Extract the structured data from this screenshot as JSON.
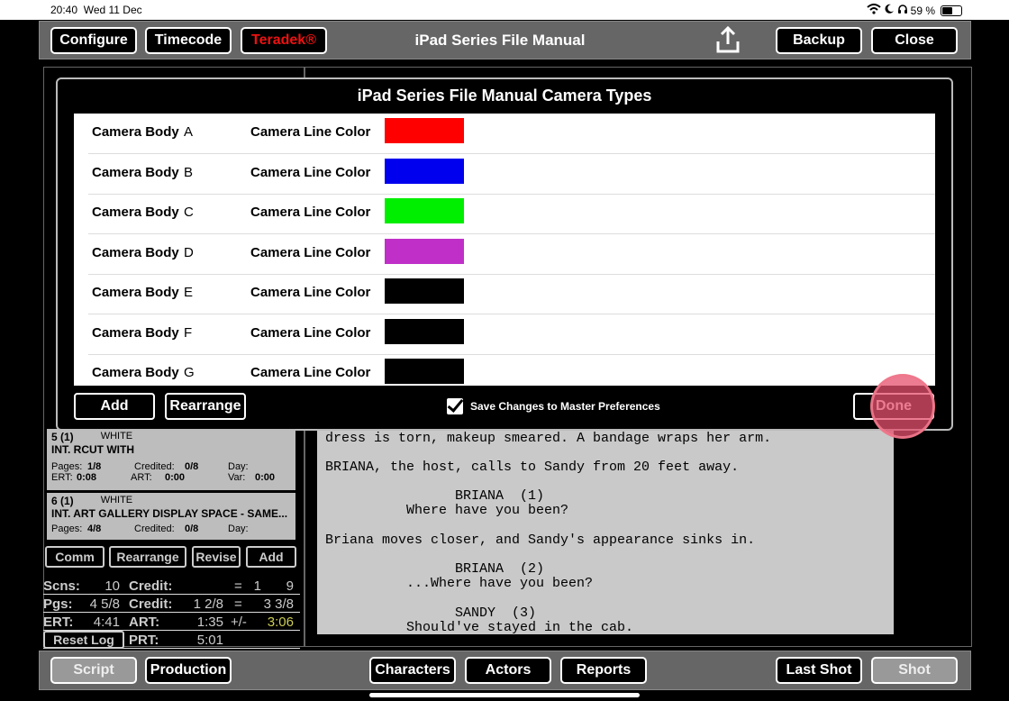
{
  "status_bar": {
    "time": "20:40",
    "date": "Wed 11 Dec",
    "battery_text": "59 %",
    "battery_level": 0.59
  },
  "toolbar": {
    "configure": "Configure",
    "timecode": "Timecode",
    "teradek": "Teradek®",
    "title": "iPad Series File Manual",
    "backup": "Backup",
    "close": "Close",
    "teradek_color": "#e11111"
  },
  "scenes": [
    {
      "num": "5 (1)",
      "color": "WHITE",
      "heading": "INT. RCUT WITH",
      "pages_label": "Pages:",
      "pages": "1/8",
      "credited_label": "Credited:",
      "credited": "0/8",
      "day_label": "Day:",
      "ert_label": "ERT:",
      "ert": "0:08",
      "art_label": "ART:",
      "art": "0:00",
      "var_label": "Var:",
      "var": "0:00"
    },
    {
      "num": "6 (1)",
      "color": "WHITE",
      "heading": "INT. ART GALLERY DISPLAY SPACE - SAME...",
      "pages_label": "Pages:",
      "pages": "4/8",
      "credited_label": "Credited:",
      "credited": "0/8",
      "day_label": "Day:"
    }
  ],
  "left_buttons": {
    "comm": "Comm",
    "rearrange": "Rearrange",
    "revise": "Revise",
    "add": "Add",
    "reset_log": "Reset Log"
  },
  "stats": {
    "scns_label": "Scns:",
    "scns": "10",
    "credit_label": "Credit:",
    "credit_scns": "1",
    "eq": "=",
    "scns_total": "9",
    "pgs_label": "Pgs:",
    "pgs": "4 5/8",
    "credit_pgs_label": "Credit:",
    "credit_pgs": "1 2/8",
    "pgs_total": "3 3/8",
    "ert_label": "ERT:",
    "ert": "4:41",
    "art_label": "ART:",
    "art": "1:35",
    "pm": "+/-",
    "diff": "3:06",
    "prt_label": "PRT:",
    "prt": "5:01"
  },
  "script_lines": [
    "dress is torn, makeup smeared. A bandage wraps her arm.",
    "BRIANA, the host, calls to Sandy from 20 feet away.",
    "                BRIANA  (1)",
    "          Where have you been?",
    "Briana moves closer, and Sandy's appearance sinks in.",
    "                BRIANA  (2)",
    "          ...Where have you been?",
    "                SANDY  (3)",
    "          Should've stayed in the cab."
  ],
  "bottom_bar": {
    "script": "Script",
    "production": "Production",
    "characters": "Characters",
    "actors": "Actors",
    "reports": "Reports",
    "last_shot": "Last Shot",
    "shot": "Shot"
  },
  "modal": {
    "title": "iPad Series File Manual Camera Types",
    "body_label": "Camera Body",
    "line_label": "Camera Line Color",
    "cameras": [
      {
        "letter": "A",
        "color": "#ff0000"
      },
      {
        "letter": "B",
        "color": "#0000ee"
      },
      {
        "letter": "C",
        "color": "#00ee00"
      },
      {
        "letter": "D",
        "color": "#c030c8"
      },
      {
        "letter": "E",
        "color": "#000000"
      },
      {
        "letter": "F",
        "color": "#000000"
      },
      {
        "letter": "G",
        "color": "#000000"
      }
    ],
    "add": "Add",
    "rearrange": "Rearrange",
    "save_label": "Save Changes to Master Preferences",
    "done": "Done"
  }
}
